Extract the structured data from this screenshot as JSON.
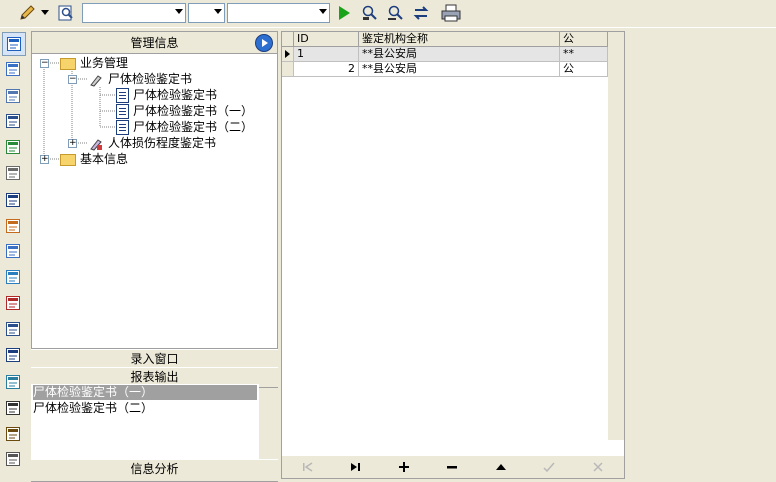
{
  "toolbar": {
    "combo1_value": "",
    "combo2_value": "",
    "combo3_value": ""
  },
  "left_icons": [
    "window-icon",
    "network-icon",
    "list-icon",
    "document-icon",
    "chart-icon",
    "envelope-icon",
    "arrow-box-icon",
    "copy-icon",
    "form-icon",
    "people-search-icon",
    "glasses-icon",
    "table-icon",
    "report-icon",
    "import-icon",
    "grid-icon",
    "user-settings-icon",
    "trash-icon"
  ],
  "mgmt": {
    "title": "管理信息",
    "tree": {
      "business": "业务管理",
      "autopsy": "尸体检验鉴定书",
      "autopsy_doc": "尸体检验鉴定书",
      "autopsy_doc1": "尸体检验鉴定书（一）",
      "autopsy_doc2": "尸体检验鉴定书（二）",
      "injury": "人体损伤程度鉴定书",
      "basic": "基本信息"
    }
  },
  "panels": {
    "entry": "录入窗口",
    "report": "报表输出",
    "analysis": "信息分析"
  },
  "report_items": [
    "尸体检验鉴定书（一）",
    "尸体检验鉴定书（二）"
  ],
  "grid": {
    "columns": [
      "ID",
      "鉴定机构全称",
      "公"
    ],
    "rows": [
      [
        "1",
        "**县公安局",
        "**"
      ],
      [
        "2",
        "**县公安局",
        "公"
      ]
    ]
  },
  "colors": {
    "selected_item_bg": "#a0a0a0",
    "selected_row_bg": "#e5e5e5",
    "panel_bg": "#ece9d8"
  }
}
